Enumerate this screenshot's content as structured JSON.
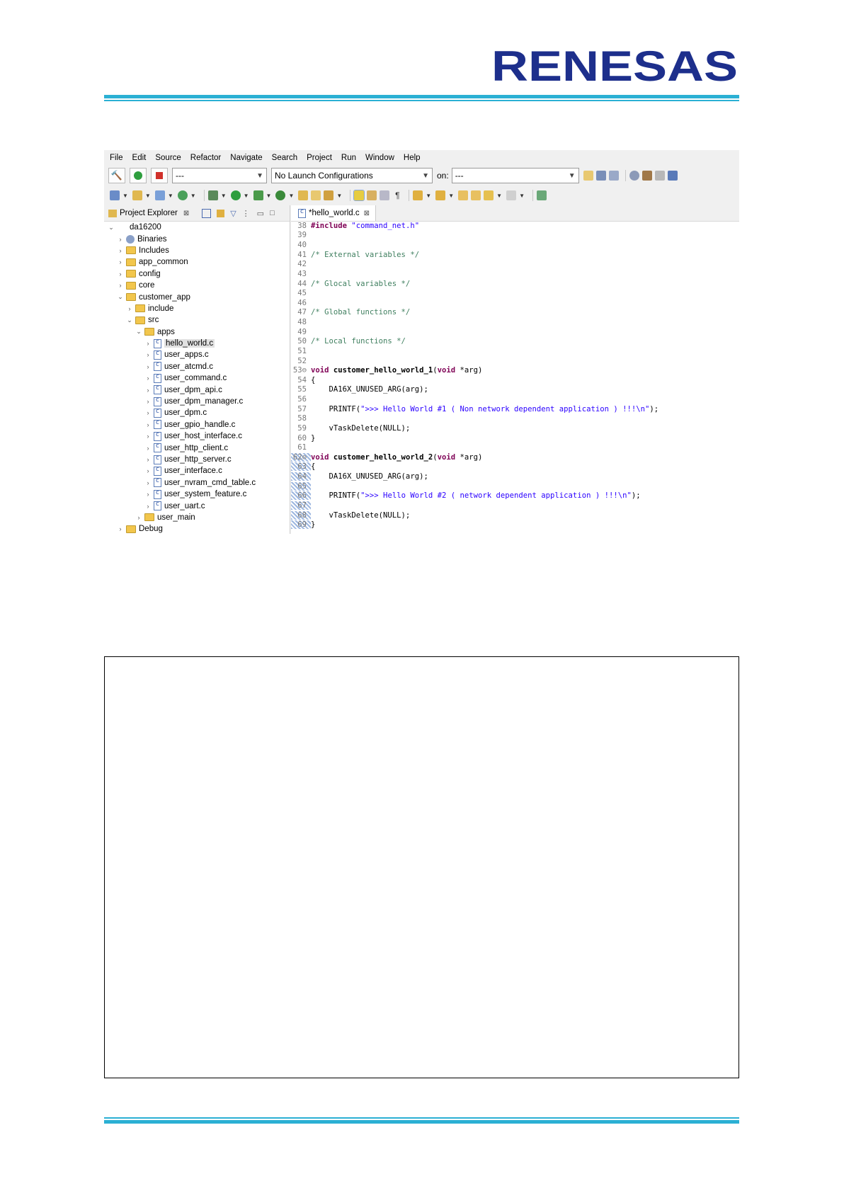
{
  "brand": {
    "logo_text": "RENESAS",
    "color": "#1d2f8c",
    "accent": "#2bb0d4"
  },
  "ide": {
    "menu": [
      "File",
      "Edit",
      "Source",
      "Refactor",
      "Navigate",
      "Search",
      "Project",
      "Run",
      "Window",
      "Help"
    ],
    "toolbar": {
      "launch_mode": "---",
      "launch_config": "No Launch Configurations",
      "on_label": "on:",
      "launch_target": "---"
    },
    "explorer": {
      "title": "Project Explorer",
      "tree": [
        {
          "label": "da16200",
          "depth": 0,
          "open": true,
          "icon": "project"
        },
        {
          "label": "Binaries",
          "depth": 1,
          "open": false,
          "icon": "gear"
        },
        {
          "label": "Includes",
          "depth": 1,
          "open": false,
          "icon": "folder"
        },
        {
          "label": "app_common",
          "depth": 1,
          "open": false,
          "icon": "folder"
        },
        {
          "label": "config",
          "depth": 1,
          "open": false,
          "icon": "folder"
        },
        {
          "label": "core",
          "depth": 1,
          "open": false,
          "icon": "folder"
        },
        {
          "label": "customer_app",
          "depth": 1,
          "open": true,
          "icon": "folder"
        },
        {
          "label": "include",
          "depth": 2,
          "open": false,
          "icon": "folder"
        },
        {
          "label": "src",
          "depth": 2,
          "open": true,
          "icon": "folder"
        },
        {
          "label": "apps",
          "depth": 3,
          "open": true,
          "icon": "folder"
        },
        {
          "label": "hello_world.c",
          "depth": 4,
          "open": false,
          "icon": "cfile",
          "selected": true
        },
        {
          "label": "user_apps.c",
          "depth": 4,
          "open": false,
          "icon": "cfile"
        },
        {
          "label": "user_atcmd.c",
          "depth": 4,
          "open": false,
          "icon": "cfile"
        },
        {
          "label": "user_command.c",
          "depth": 4,
          "open": false,
          "icon": "cfile"
        },
        {
          "label": "user_dpm_api.c",
          "depth": 4,
          "open": false,
          "icon": "cfile"
        },
        {
          "label": "user_dpm_manager.c",
          "depth": 4,
          "open": false,
          "icon": "cfile"
        },
        {
          "label": "user_dpm.c",
          "depth": 4,
          "open": false,
          "icon": "cfile"
        },
        {
          "label": "user_gpio_handle.c",
          "depth": 4,
          "open": false,
          "icon": "cfile"
        },
        {
          "label": "user_host_interface.c",
          "depth": 4,
          "open": false,
          "icon": "cfile"
        },
        {
          "label": "user_http_client.c",
          "depth": 4,
          "open": false,
          "icon": "cfile"
        },
        {
          "label": "user_http_server.c",
          "depth": 4,
          "open": false,
          "icon": "cfile"
        },
        {
          "label": "user_interface.c",
          "depth": 4,
          "open": false,
          "icon": "cfile"
        },
        {
          "label": "user_nvram_cmd_table.c",
          "depth": 4,
          "open": false,
          "icon": "cfile"
        },
        {
          "label": "user_system_feature.c",
          "depth": 4,
          "open": false,
          "icon": "cfile"
        },
        {
          "label": "user_uart.c",
          "depth": 4,
          "open": false,
          "icon": "cfile"
        },
        {
          "label": "user_main",
          "depth": 3,
          "open": false,
          "icon": "folder"
        },
        {
          "label": "Debug",
          "depth": 1,
          "open": false,
          "icon": "folder"
        }
      ]
    },
    "editor": {
      "tab_title": "*hello_world.c",
      "lines": [
        {
          "n": "38",
          "segs": [
            [
              "kw",
              "#include "
            ],
            [
              "str",
              "\"command_net.h\""
            ]
          ]
        },
        {
          "n": "39",
          "segs": []
        },
        {
          "n": "40",
          "segs": []
        },
        {
          "n": "41",
          "segs": [
            [
              "com",
              "/* External variables */"
            ]
          ]
        },
        {
          "n": "42",
          "segs": []
        },
        {
          "n": "43",
          "segs": []
        },
        {
          "n": "44",
          "segs": [
            [
              "com",
              "/* Glocal variables */"
            ]
          ]
        },
        {
          "n": "45",
          "segs": []
        },
        {
          "n": "46",
          "segs": []
        },
        {
          "n": "47",
          "segs": [
            [
              "com",
              "/* Global functions */"
            ]
          ]
        },
        {
          "n": "48",
          "segs": []
        },
        {
          "n": "49",
          "segs": []
        },
        {
          "n": "50",
          "segs": [
            [
              "com",
              "/* Local functions */"
            ]
          ]
        },
        {
          "n": "51",
          "segs": []
        },
        {
          "n": "52",
          "segs": []
        },
        {
          "n": "53⊖",
          "segs": [
            [
              "kw",
              "void "
            ],
            [
              "fn",
              "customer_hello_world_1"
            ],
            [
              "txt",
              "("
            ],
            [
              "kw",
              "void"
            ],
            [
              "txt",
              " *arg)"
            ]
          ]
        },
        {
          "n": "54",
          "segs": [
            [
              "txt",
              "{"
            ]
          ]
        },
        {
          "n": "55",
          "segs": [
            [
              "txt",
              "    DA16X_UNUSED_ARG(arg);"
            ]
          ]
        },
        {
          "n": "56",
          "segs": []
        },
        {
          "n": "57",
          "segs": [
            [
              "txt",
              "    PRINTF("
            ],
            [
              "str",
              "\">>> Hello World #1 ( Non network dependent application ) !!!\\n\""
            ],
            [
              "txt",
              ");"
            ]
          ]
        },
        {
          "n": "58",
          "segs": []
        },
        {
          "n": "59",
          "segs": [
            [
              "txt",
              "    vTaskDelete(NULL);"
            ]
          ]
        },
        {
          "n": "60",
          "segs": [
            [
              "txt",
              "}"
            ]
          ]
        },
        {
          "n": "61",
          "segs": []
        },
        {
          "n": "62⊖",
          "segs": [
            [
              "kw",
              "void "
            ],
            [
              "fn",
              "customer_hello_world_2"
            ],
            [
              "txt",
              "("
            ],
            [
              "kw",
              "void"
            ],
            [
              "txt",
              " *arg)"
            ]
          ],
          "changed": true
        },
        {
          "n": "63",
          "segs": [
            [
              "txt",
              "{"
            ]
          ],
          "changed": true
        },
        {
          "n": "64",
          "segs": [
            [
              "txt",
              "    DA16X_UNUSED_ARG(arg);"
            ]
          ],
          "changed": true
        },
        {
          "n": "65",
          "segs": [],
          "changed": true
        },
        {
          "n": "66",
          "segs": [
            [
              "txt",
              "    PRINTF("
            ],
            [
              "str",
              "\">>> Hello World #2 ( network dependent application ) !!!\\n\""
            ],
            [
              "txt",
              ");"
            ]
          ],
          "changed": true
        },
        {
          "n": "67",
          "segs": [],
          "changed": true
        },
        {
          "n": "68",
          "segs": [
            [
              "txt",
              "    vTaskDelete(NULL);"
            ]
          ],
          "changed": true
        },
        {
          "n": "69",
          "segs": [
            [
              "txt",
              "}"
            ]
          ],
          "changed": true
        }
      ]
    }
  }
}
